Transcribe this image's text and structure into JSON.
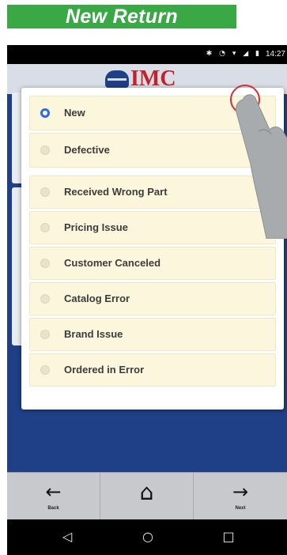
{
  "banner": {
    "title": "New Return"
  },
  "status_bar": {
    "icons": [
      "bluetooth-icon",
      "alarm-icon",
      "wifi-icon",
      "signal-icon",
      "battery-icon"
    ],
    "icons_text": "✱ ◔ ▾ ◢ ▮",
    "time": "14:27"
  },
  "header": {
    "logo_text": "IMC"
  },
  "dialog": {
    "options": [
      {
        "label": "New",
        "selected": true
      },
      {
        "label": "Defective",
        "selected": false
      },
      {
        "label": "Received Wrong Part",
        "selected": false
      },
      {
        "label": "Pricing Issue",
        "selected": false
      },
      {
        "label": "Customer Canceled",
        "selected": false
      },
      {
        "label": "Catalog Error",
        "selected": false
      },
      {
        "label": "Brand Issue",
        "selected": false
      },
      {
        "label": "Ordered in Error",
        "selected": false
      }
    ]
  },
  "bottom_nav": {
    "back_label": "Back",
    "back_icon": "←",
    "home_icon": "⌂",
    "next_label": "Next",
    "next_icon": "→"
  },
  "system_nav": {
    "back": "◁",
    "home": "○",
    "recents": "□"
  },
  "colors": {
    "banner_green": "#3aa845",
    "app_blue": "#1f3f86",
    "logo_red": "#c3222a",
    "option_bg": "#fbf6dc",
    "radio_selected": "#2a6fd6",
    "touch_indicator": "#d0303a"
  }
}
